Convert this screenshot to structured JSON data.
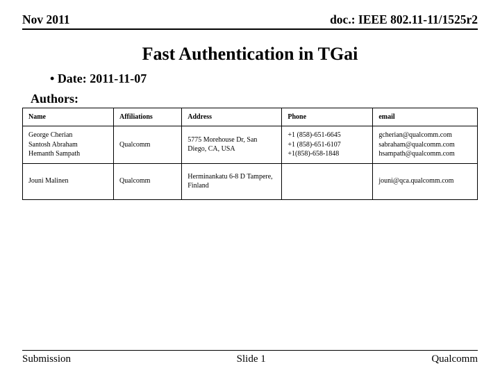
{
  "header": {
    "left": "Nov 2011",
    "right": "doc.: IEEE 802.11-11/1525r2"
  },
  "title": "Fast Authentication in TGai",
  "date_line": "Date: 2011-11-07",
  "authors_label": "Authors:",
  "table": {
    "headers": [
      "Name",
      "Affiliations",
      "Address",
      "Phone",
      "email"
    ],
    "rows": [
      {
        "name": "George Cherian\nSantosh Abraham\nHemanth Sampath",
        "affil": "Qualcomm",
        "addr": "5775 Morehouse Dr, San Diego, CA, USA",
        "phone": "+1 (858)-651-6645\n+1 (858)-651-6107\n+1(858)-658-1848",
        "email": "gcherian@qualcomm.com\nsabraham@qualcomm.com\nhsampath@qualcomm.com"
      },
      {
        "name": "Jouni Malinen",
        "affil": "Qualcomm",
        "addr": "Herminankatu 6-8 D Tampere, Finland",
        "phone": "",
        "email": "jouni@qca.qualcomm.com"
      }
    ]
  },
  "footer": {
    "left": "Submission",
    "center": "Slide 1",
    "right": "Qualcomm"
  }
}
